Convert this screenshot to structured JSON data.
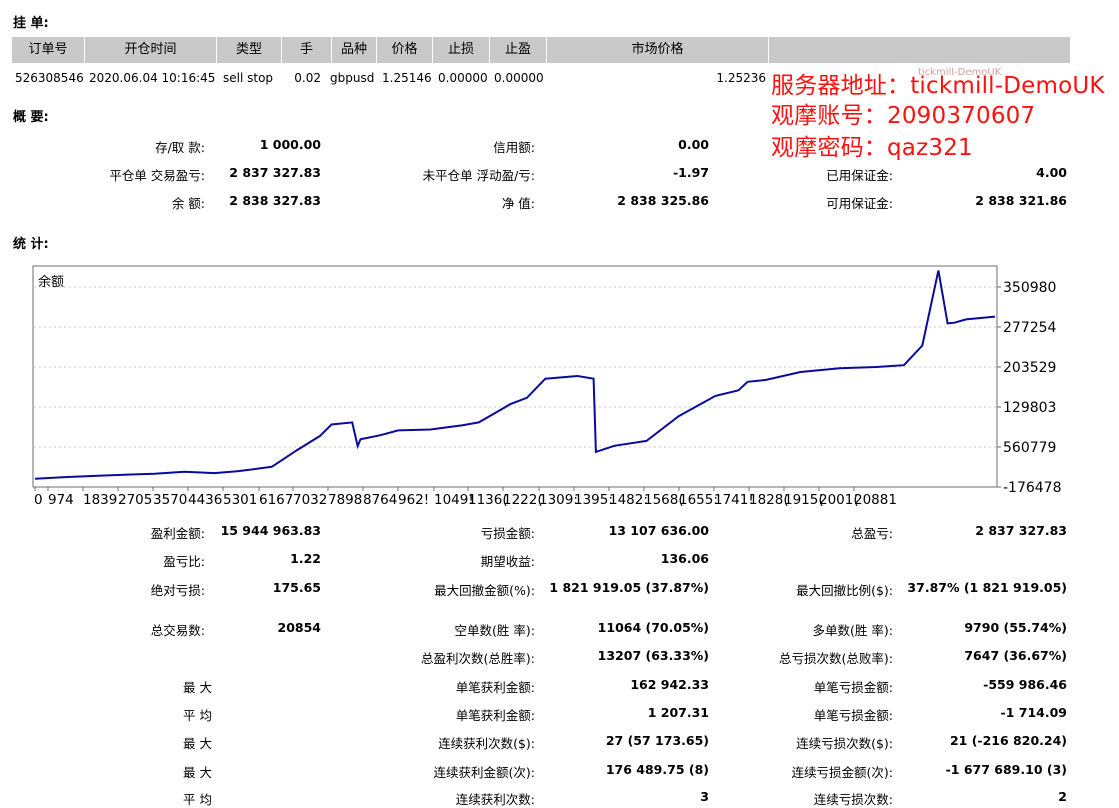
{
  "sections": {
    "orders": "挂 单:",
    "summary": "概 要:",
    "stats": "统 计:"
  },
  "order_table": {
    "headers": [
      "订单号",
      "开仓时间",
      "类型",
      "手",
      "品种",
      "价格",
      "止损",
      "止盈",
      "市场价格",
      ""
    ],
    "row": [
      "526308546",
      "2020.06.04 10:16:45",
      "sell stop",
      "0.02",
      "gbpusd",
      "1.25146",
      "0.00000",
      "0.00000",
      "1.25236"
    ]
  },
  "summary": [
    [
      {
        "l": "存/取 款:",
        "v": "1 000.00"
      },
      {
        "l": "信用额:",
        "v": "0.00"
      },
      {
        "l": "",
        "v": ""
      }
    ],
    [
      {
        "l": "平仓单 交易盈亏:",
        "v": "2 837 327.83"
      },
      {
        "l": "未平仓单 浮动盈/亏:",
        "v": "-1.97"
      },
      {
        "l": "已用保证金:",
        "v": "4.00"
      }
    ],
    [
      {
        "l": "余 额:",
        "v": "2 838 327.83"
      },
      {
        "l": "净 值:",
        "v": "2 838 325.86"
      },
      {
        "l": "可用保证金:",
        "v": "2 838 321.86"
      }
    ]
  ],
  "chart_data": {
    "type": "line",
    "title": "余额",
    "x_ticks": [
      "0",
      "974",
      "1839",
      "2705",
      "3570",
      "4436",
      "5301",
      "6167",
      "7032",
      "7898",
      "8764",
      "962!",
      "1049!",
      "1136(",
      "1222(",
      "1309:",
      "1395:",
      "1482:",
      "1568(",
      "1655:",
      "1741!",
      "1828(",
      "1915(",
      "2001(",
      "20881"
    ],
    "y_ticks": [
      "350980",
      "277254",
      "203529",
      "129803",
      "560779",
      "-176478"
    ],
    "xlim": [
      0,
      20881
    ],
    "ylim": [
      -17647,
      3509803
    ],
    "series": [
      {
        "color": "#0a0a9c",
        "x": [
          0,
          650,
          1300,
          1950,
          2600,
          3250,
          3900,
          4400,
          4750,
          5150,
          5700,
          6200,
          6450,
          6900,
          7020,
          7080,
          7500,
          7900,
          8600,
          9300,
          9650,
          10000,
          10350,
          10700,
          11100,
          11800,
          12150,
          12200,
          12600,
          13300,
          14000,
          14800,
          15300,
          15500,
          15900,
          16650,
          17500,
          18300,
          18900,
          19300,
          19650,
          19850,
          20000,
          20250,
          20881
        ],
        "y": [
          83000,
          110000,
          130000,
          150000,
          165000,
          198000,
          175000,
          205000,
          240000,
          278000,
          550000,
          780000,
          965000,
          1000000,
          615000,
          725000,
          790000,
          870000,
          885000,
          955000,
          1000000,
          1150000,
          1300000,
          1400000,
          1710000,
          1755000,
          1710000,
          520000,
          620000,
          700000,
          1100000,
          1430000,
          1520000,
          1660000,
          1690000,
          1820000,
          1880000,
          1900000,
          1930000,
          2250000,
          3470000,
          2610000,
          2620000,
          2675000,
          2720000
        ]
      }
    ]
  },
  "stats": [
    [
      {
        "l": "盈利金额:",
        "v": "15 944 963.83"
      },
      {
        "l": "亏损金额:",
        "v": "13 107 636.00"
      },
      {
        "l": "总盈亏:",
        "v": "2 837 327.83"
      }
    ],
    [
      {
        "l": "盈亏比:",
        "v": "1.22"
      },
      {
        "l": "期望收益:",
        "v": "136.06"
      },
      {
        "l": "",
        "v": ""
      }
    ],
    [
      {
        "l": "绝对亏损:",
        "v": "175.65"
      },
      {
        "l": "最大回撤金额(%):",
        "v": "1 821 919.05 (37.87%)"
      },
      {
        "l": "最大回撤比例($):",
        "v": "37.87% (1 821 919.05)"
      }
    ],
    [
      {
        "l": "总交易数:",
        "v": "20854"
      },
      {
        "l": "空单数(胜 率):",
        "v": "11064 (70.05%)"
      },
      {
        "l": "多单数(胜 率):",
        "v": "9790 (55.74%)"
      }
    ],
    [
      {
        "l": "",
        "v": ""
      },
      {
        "l": "总盈利次数(总胜率):",
        "v": "13207 (63.33%)"
      },
      {
        "l": "总亏损次数(总败率):",
        "v": "7647 (36.67%)"
      }
    ],
    [
      {
        "l": "最 大",
        "v": ""
      },
      {
        "l": "单笔获利金额:",
        "v": "162 942.33"
      },
      {
        "l": "单笔亏损金额:",
        "v": "-559 986.46"
      }
    ],
    [
      {
        "l": "平 均",
        "v": ""
      },
      {
        "l": "单笔获利金额:",
        "v": "1 207.31"
      },
      {
        "l": "单笔亏损金额:",
        "v": "-1 714.09"
      }
    ],
    [
      {
        "l": "最 大",
        "v": ""
      },
      {
        "l": "连续获利次数($):",
        "v": "27 (57 173.65)"
      },
      {
        "l": "连续亏损次数($):",
        "v": "21 (-216 820.24)"
      }
    ],
    [
      {
        "l": "最 大",
        "v": ""
      },
      {
        "l": "连续获利金额(次):",
        "v": "176 489.75 (8)"
      },
      {
        "l": "连续亏损金额(次):",
        "v": "-1 677 689.10 (3)"
      }
    ],
    [
      {
        "l": "平 均",
        "v": ""
      },
      {
        "l": "连续获利次数:",
        "v": "3"
      },
      {
        "l": "连续亏损次数:",
        "v": "2"
      }
    ]
  ],
  "watermark": {
    "line1": "服务器地址：tickmill-DemoUK",
    "line2": "观摩账号：2090370607",
    "line3": "观摩密码：qaz321",
    "faint": "tickmill-DemoUK"
  }
}
